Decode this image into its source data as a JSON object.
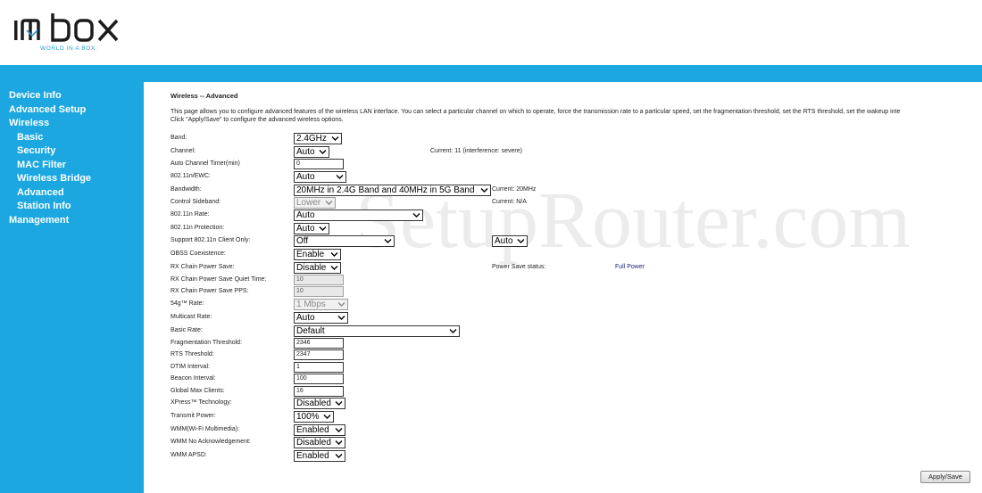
{
  "brand": {
    "logo_text": "im box",
    "tagline": "WORLD IN A BOX."
  },
  "sidebar": {
    "items": [
      {
        "label": "Device Info"
      },
      {
        "label": "Advanced Setup"
      },
      {
        "label": "Wireless"
      },
      {
        "label": "Basic"
      },
      {
        "label": "Security"
      },
      {
        "label": "MAC Filter"
      },
      {
        "label": "Wireless Bridge"
      },
      {
        "label": "Advanced"
      },
      {
        "label": "Station Info"
      },
      {
        "label": "Management"
      }
    ]
  },
  "watermark": "SetupRouter.com",
  "page": {
    "title": "Wireless -- Advanced",
    "desc_line1": "This page allows you to configure advanced features of the wireless LAN interface. You can select a particular channel on which to operate, force the transmission rate to a particular speed, set the fragmentation threshold, set the RTS threshold, set the wakeup inte",
    "desc_line2": "Click \"Apply/Save\" to configure the advanced wireless options."
  },
  "fields": {
    "band": {
      "label": "Band:",
      "value": "2.4GHz"
    },
    "channel": {
      "label": "Channel:",
      "value": "Auto",
      "status": "Current: 11 (interference: severe)"
    },
    "auto_channel_timer": {
      "label": "Auto Channel Timer(min)",
      "value": "0"
    },
    "ewc": {
      "label": "802.11n/EWC:",
      "value": "Auto"
    },
    "bandwidth": {
      "label": "Bandwidth:",
      "value": "20MHz in 2.4G Band and 40MHz in 5G Band",
      "status": "Current: 20MHz"
    },
    "control_sideband": {
      "label": "Control Sideband:",
      "value": "Lower",
      "status": "Current: N/A"
    },
    "n_rate": {
      "label": "802.11n Rate:",
      "value": "Auto"
    },
    "n_protection": {
      "label": "802.11n Protection:",
      "value": "Auto"
    },
    "n_client_only": {
      "label": "Support 802.11n Client Only:",
      "value": "Off",
      "value2": "Auto"
    },
    "obss": {
      "label": "OBSS Coexistence:",
      "value": "Enable"
    },
    "rx_chain_power_save": {
      "label": "RX Chain Power Save:",
      "value": "Disable",
      "status_label": "Power Save status:",
      "status_value": "Full Power"
    },
    "rx_quiet_time": {
      "label": "RX Chain Power Save Quiet Time:",
      "value": "10"
    },
    "rx_pps": {
      "label": "RX Chain Power Save PPS:",
      "value": "10"
    },
    "g_rate": {
      "label": "54g™ Rate:",
      "value": "1 Mbps"
    },
    "multicast_rate": {
      "label": "Multicast Rate:",
      "value": "Auto"
    },
    "basic_rate": {
      "label": "Basic Rate:",
      "value": "Default"
    },
    "frag_threshold": {
      "label": "Fragmentation Threshold:",
      "value": "2346"
    },
    "rts_threshold": {
      "label": "RTS Threshold:",
      "value": "2347"
    },
    "dtim_interval": {
      "label": "DTIM Interval:",
      "value": "1"
    },
    "beacon_interval": {
      "label": "Beacon Interval:",
      "value": "100"
    },
    "global_max_clients": {
      "label": "Global Max Clients:",
      "value": "16"
    },
    "xpress": {
      "label": "XPress™ Technology:",
      "value": "Disabled"
    },
    "transmit_power": {
      "label": "Transmit Power:",
      "value": "100%"
    },
    "wmm": {
      "label": "WMM(Wi-Fi Multimedia):",
      "value": "Enabled"
    },
    "wmm_no_ack": {
      "label": "WMM No Acknowledgement:",
      "value": "Disabled"
    },
    "wmm_apsd": {
      "label": "WMM APSD:",
      "value": "Enabled"
    }
  },
  "buttons": {
    "apply_save": "Apply/Save"
  },
  "colors": {
    "accent": "#1ca7e0",
    "status_value": "#1a237e"
  }
}
